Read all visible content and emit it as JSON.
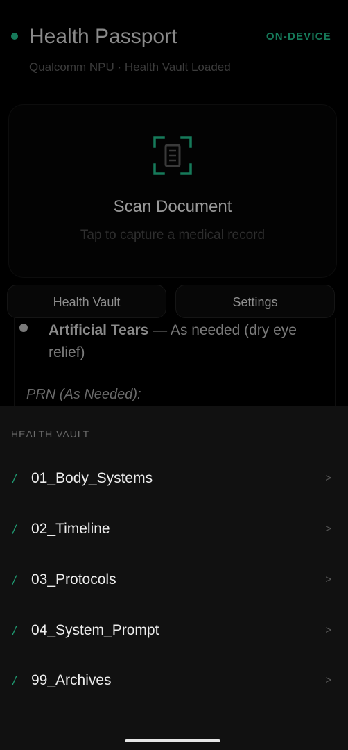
{
  "colors": {
    "accent": "#1f9e74",
    "accent_dim": "#167a5a",
    "sheet_bg": "#111111"
  },
  "header": {
    "title": "Health Passport",
    "subtitle": "Qualcomm NPU · Health Vault Loaded",
    "mode_badge": "ON-DEVICE"
  },
  "scan_card": {
    "icon": "document-scan-icon",
    "title": "Scan Document",
    "hint": "Tap to capture a medical record"
  },
  "actions": {
    "vault_label": "Health Vault",
    "settings_label": "Settings"
  },
  "background_content": {
    "med_name": "Artificial Tears",
    "med_detail": " — As needed (dry eye relief)",
    "prn_heading": "PRN (As Needed):"
  },
  "sheet": {
    "label": "HEALTH VAULT",
    "items": [
      {
        "slash": "/",
        "label": "01_Body_Systems",
        "chevron": ">"
      },
      {
        "slash": "/",
        "label": "02_Timeline",
        "chevron": ">"
      },
      {
        "slash": "/",
        "label": "03_Protocols",
        "chevron": ">"
      },
      {
        "slash": "/",
        "label": "04_System_Prompt",
        "chevron": ">"
      },
      {
        "slash": "/",
        "label": "99_Archives",
        "chevron": ">"
      }
    ]
  }
}
